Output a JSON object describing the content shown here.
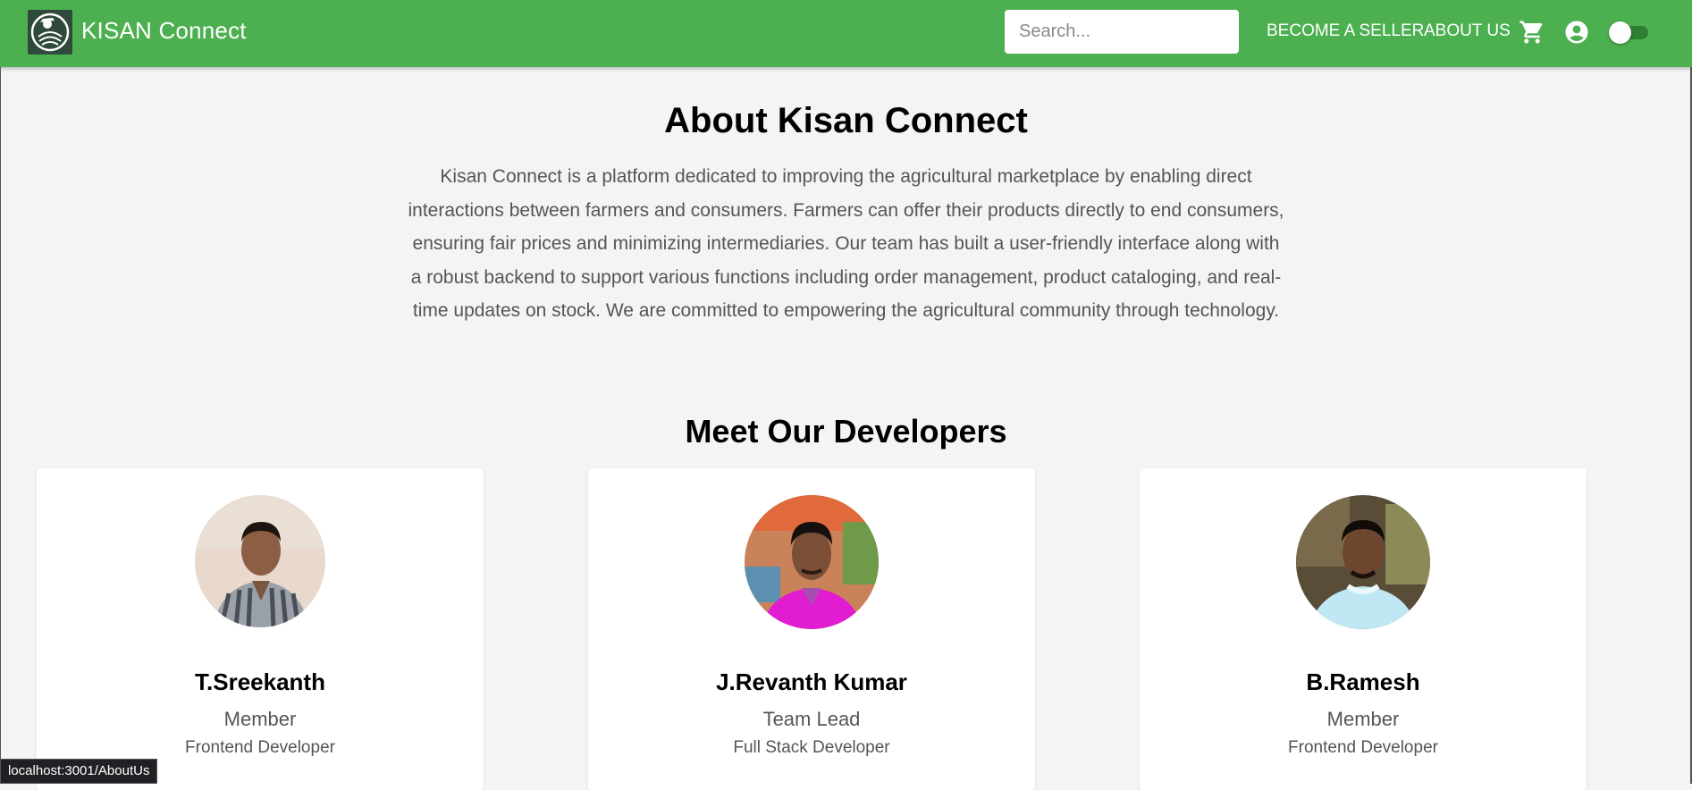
{
  "header": {
    "brand": "KISAN Connect",
    "search_placeholder": "Search...",
    "become_seller": "BECOME A SELLER",
    "about_us": "ABOUT US",
    "icons": [
      "cart-icon",
      "account-circle-icon",
      "theme-toggle"
    ]
  },
  "about": {
    "title": "About Kisan Connect",
    "text": "Kisan Connect is a platform dedicated to improving the agricultural marketplace by enabling direct interactions between farmers and consumers. Farmers can offer their products directly to end consumers, ensuring fair prices and minimizing intermediaries. Our team has built a user-friendly interface along with a robust backend to support various functions including order management, product cataloging, and real-time updates on stock. We are committed to empowering the agricultural community through technology."
  },
  "developers": {
    "title": "Meet Our Developers",
    "cards": [
      {
        "name": "T.Sreekanth",
        "role": "Member",
        "spec": "Frontend Developer"
      },
      {
        "name": "J.Revanth Kumar",
        "role": "Team Lead",
        "spec": "Full Stack Developer"
      },
      {
        "name": "B.Ramesh",
        "role": "Member",
        "spec": "Frontend Developer"
      }
    ]
  },
  "status_bar": {
    "url": "localhost:3001/AboutUs"
  },
  "colors": {
    "appbar": "#4caf50",
    "background": "#f3f4f6",
    "toggle_track": "#2e7d32"
  }
}
